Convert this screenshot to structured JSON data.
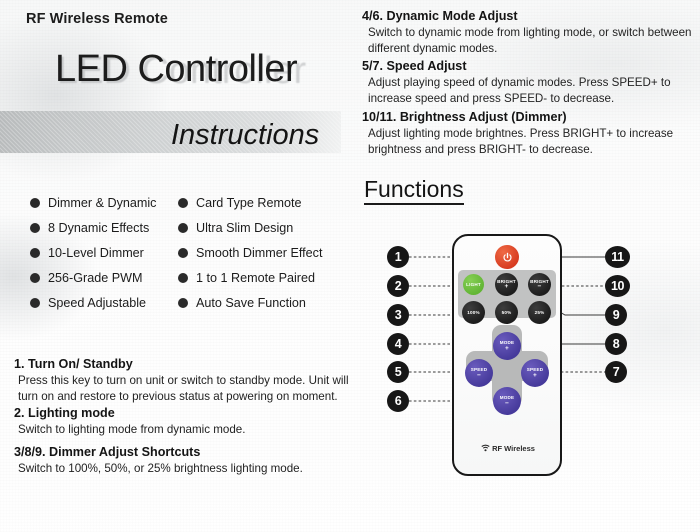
{
  "header": {
    "kicker": "RF Wireless Remote",
    "title": "LED Controller",
    "subtitle": "Instructions"
  },
  "features": {
    "left": [
      "Dimmer & Dynamic",
      "8 Dynamic Effects",
      "10-Level Dimmer",
      "256-Grade PWM",
      "Speed Adjustable"
    ],
    "right": [
      "Card Type Remote",
      "Ultra Slim Design",
      "Smooth Dimmer Effect",
      "1 to 1 Remote Paired",
      "Auto Save Function"
    ]
  },
  "instructions_left": [
    {
      "heading": "1. Turn On/ Standby",
      "body": "Press this key to turn on unit or switch to standby mode. Unit will turn on and restore to previous status at powering on moment."
    },
    {
      "heading": "2. Lighting mode",
      "body": "Switch to lighting  mode from dynamic mode."
    },
    {
      "heading": "3/8/9. Dimmer Adjust Shortcuts",
      "body": "Switch to 100%, 50%, or 25%  brightness lighting mode."
    }
  ],
  "instructions_right": [
    {
      "heading": "4/6. Dynamic Mode Adjust",
      "body": "Switch to dynamic mode from lighting mode, or switch between different dynamic modes."
    },
    {
      "heading": "5/7. Speed Adjust",
      "body": "Adjust playing speed of dynamic modes. Press SPEED+ to increase speed and press SPEED- to decrease."
    },
    {
      "heading": "10/11. Brightness Adjust (Dimmer)",
      "body": "Adjust lighting mode brightnes. Press BRIGHT+ to increase brightness and press BRIGHT- to decrease."
    }
  ],
  "functions": {
    "title": "Functions",
    "remote": {
      "brand_label": "RF Wireless",
      "buttons": {
        "power": "",
        "light": "LIGHT",
        "bright_plus_top": "BRIGHT",
        "bright_plus_sign": "+",
        "bright_minus_top": "BRIGHT",
        "bright_minus_sign": "−",
        "pct100": "100%",
        "pct50": "50%",
        "pct25": "25%",
        "mode_plus_top": "MODE",
        "mode_plus_sign": "+",
        "mode_minus_top": "MODE",
        "mode_minus_sign": "−",
        "speed_minus_top": "SPEED",
        "speed_minus_sign": "−",
        "speed_plus_top": "SPEED",
        "speed_plus_sign": "+"
      }
    },
    "callouts": [
      {
        "n": "1",
        "target": "power"
      },
      {
        "n": "2",
        "target": "light"
      },
      {
        "n": "3",
        "target": "100%"
      },
      {
        "n": "4",
        "target": "MODE+"
      },
      {
        "n": "5",
        "target": "SPEED-"
      },
      {
        "n": "6",
        "target": "MODE-"
      },
      {
        "n": "7",
        "target": "SPEED+"
      },
      {
        "n": "8",
        "target": "25%"
      },
      {
        "n": "9",
        "target": "50%"
      },
      {
        "n": "10",
        "target": "BRIGHT-"
      },
      {
        "n": "11",
        "target": "BRIGHT+"
      }
    ]
  },
  "colors": {
    "power": "#d73b20",
    "light": "#62b534",
    "dark_button": "#1d1d1d",
    "purple_button": "#463a9b",
    "keypad_gray": "#bcbdbd",
    "ink": "#1b1b1b"
  }
}
